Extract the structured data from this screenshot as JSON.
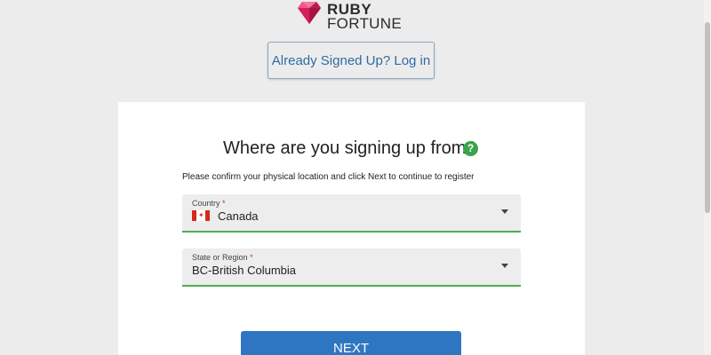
{
  "brand": {
    "line1": "RUBY",
    "line2": "FORTUNE",
    "logo_icon": "ruby-gem-icon",
    "accent": "#e0245e"
  },
  "login_button": "Already Signed Up? Log in",
  "form": {
    "heading": "Where are you signing up from?",
    "help_icon": "question-icon",
    "help_glyph": "?",
    "instruction": "Please confirm your physical location and click Next to continue to register",
    "country": {
      "label": "Country",
      "required_mark": "*",
      "value": "Canada",
      "flag_icon": "canada-flag-icon"
    },
    "region": {
      "label": "State or Region",
      "required_mark": "*",
      "value": "BC-British Columbia"
    },
    "next_button": "NEXT"
  },
  "colors": {
    "primary_button": "#2f76c2",
    "field_underline": "#4caf50",
    "help_icon": "#3aa44b",
    "required": "#d32f2f"
  }
}
